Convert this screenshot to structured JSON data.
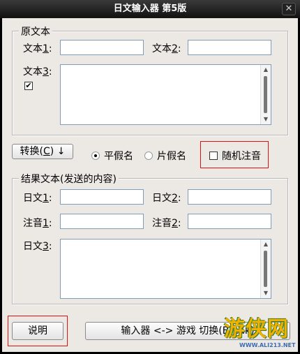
{
  "window": {
    "title": "日文输入器 第5版",
    "close_glyph": "✕"
  },
  "source_group": {
    "legend": "原文本",
    "text1_label": "文本",
    "text1_key": "1",
    "text1_suffix": ":",
    "text2_label": "文本",
    "text2_key": "2",
    "text2_suffix": ":",
    "text3_label": "文本",
    "text3_key": "3",
    "text3_suffix": ":",
    "text1_value": "",
    "text2_value": "",
    "text3_value": "",
    "checkbox_checked": true,
    "check_glyph": "✔"
  },
  "controls": {
    "convert_label": "转换(",
    "convert_key": "C",
    "convert_suffix": ") ↓",
    "hiragana_label": "平假名",
    "hiragana_selected": true,
    "katakana_label": "片假名",
    "katakana_selected": false,
    "random_ruby_label": "随机注音",
    "random_ruby_checked": false
  },
  "result_group": {
    "legend": "结果文本(发送的内容)",
    "jp1_label": "日文",
    "jp1_key": "1",
    "jp1_suffix": ":",
    "jp2_label": "日文",
    "jp2_key": "2",
    "jp2_suffix": ":",
    "ruby1_label": "注音",
    "ruby1_key": "1",
    "ruby1_suffix": ":",
    "ruby2_label": "注音",
    "ruby2_key": "2",
    "ruby2_suffix": ":",
    "jp3_label": "日文",
    "jp3_key": "3",
    "jp3_suffix": ":"
  },
  "footer": {
    "help_label": "说明",
    "toggle_label": "输入器 <-> 游戏 切换(Break)"
  },
  "watermark": {
    "logo_text": "游侠网",
    "url_text": "WWW.ALI213.NET"
  },
  "colors": {
    "highlight_box": "#e01010",
    "client_bg": "#ece9e4"
  }
}
